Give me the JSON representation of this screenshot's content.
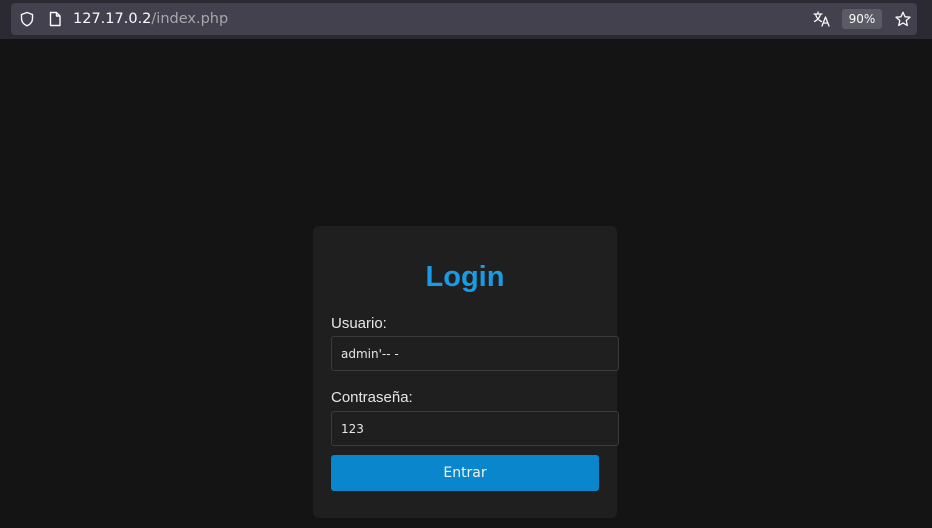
{
  "browser": {
    "url_host": "127.17.0.2",
    "url_path": "/index.php",
    "zoom_level": "90%",
    "icons": [
      "shield-icon",
      "page-icon",
      "translate-icon",
      "star-icon"
    ]
  },
  "login_card": {
    "title": "Login",
    "username_label": "Usuario:",
    "username_value": "admin'-- -",
    "password_label": "Contraseña:",
    "password_value": "123",
    "submit_label": "Entrar"
  },
  "colors": {
    "page_background": "#141414",
    "card_background": "#1f1f1f",
    "title_color": "#1a9be6",
    "button_color": "#0a87cc"
  }
}
